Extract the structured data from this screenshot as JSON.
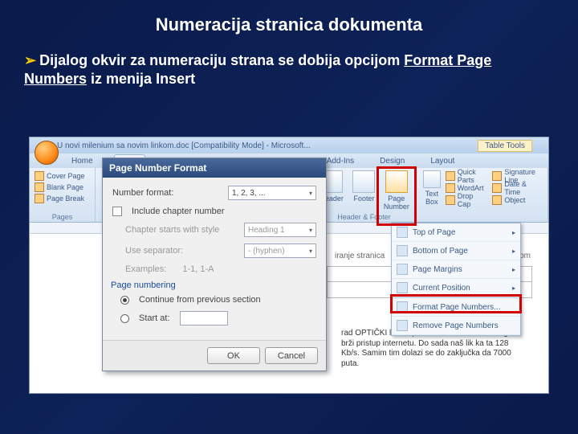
{
  "slide": {
    "title": "Numeracija stranica dokumenta",
    "body_prefix": "Dijalog okvir za numeraciju strana se dobija opcijom",
    "body_bold1": "Format Page Numbers",
    "body_mid": " iz menija ",
    "body_bold2": "Insert"
  },
  "word": {
    "titlebar": "U novi milenium sa novim linkom.doc [Compatibility Mode] - Microsoft...",
    "table_tools": "Table Tools",
    "tabs": {
      "home": "Home",
      "insert": "Insert",
      "addins": "Add-Ins",
      "design": "Design",
      "layout": "Layout"
    },
    "ribbon": {
      "pages_group": "Pages",
      "cover_page": "Cover Page",
      "blank_page": "Blank Page",
      "page_break": "Page Break",
      "header": "Header",
      "footer": "Footer",
      "page_number": "Page Number",
      "header_footer_group": "Header & Footer",
      "text_box": "Text Box",
      "quick_parts": "Quick Parts",
      "wordart": "WordArt",
      "drop_cap": "Drop Cap",
      "signature": "Signature Line",
      "date_time": "Date & Time",
      "object": "Object"
    },
    "dropdown": {
      "top": "Top of Page",
      "bottom": "Bottom of Page",
      "margins": "Page Margins",
      "current": "Current Position",
      "format": "Format Page Numbers...",
      "remove": "Remove Page Numbers"
    },
    "dialog": {
      "title": "Page Number Format",
      "number_format_label": "Number format:",
      "number_format_value": "1, 2, 3, ...",
      "include_chapter": "Include chapter number",
      "chapter_starts": "Chapter starts with style",
      "chapter_style_value": "Heading 1",
      "use_separator": "Use separator:",
      "separator_value": "-   (hyphen)",
      "examples_label": "Examples:",
      "examples_value": "1-1, 1-A",
      "page_numbering": "Page numbering",
      "continue": "Continue from previous section",
      "start_at": "Start at:",
      "ok": "OK",
      "cancel": "Cancel"
    },
    "doc": {
      "header_text": "iranje stranica",
      "header_right": "vkom",
      "body_text": "rad OPTIČKI link kapaciteta 1 Gb/s što nam ogo brži pristup internetu. Do sada naš lik ka ta 128 Kb/s. Samim tim dolazi se do zaključka da 7000 puta."
    }
  }
}
